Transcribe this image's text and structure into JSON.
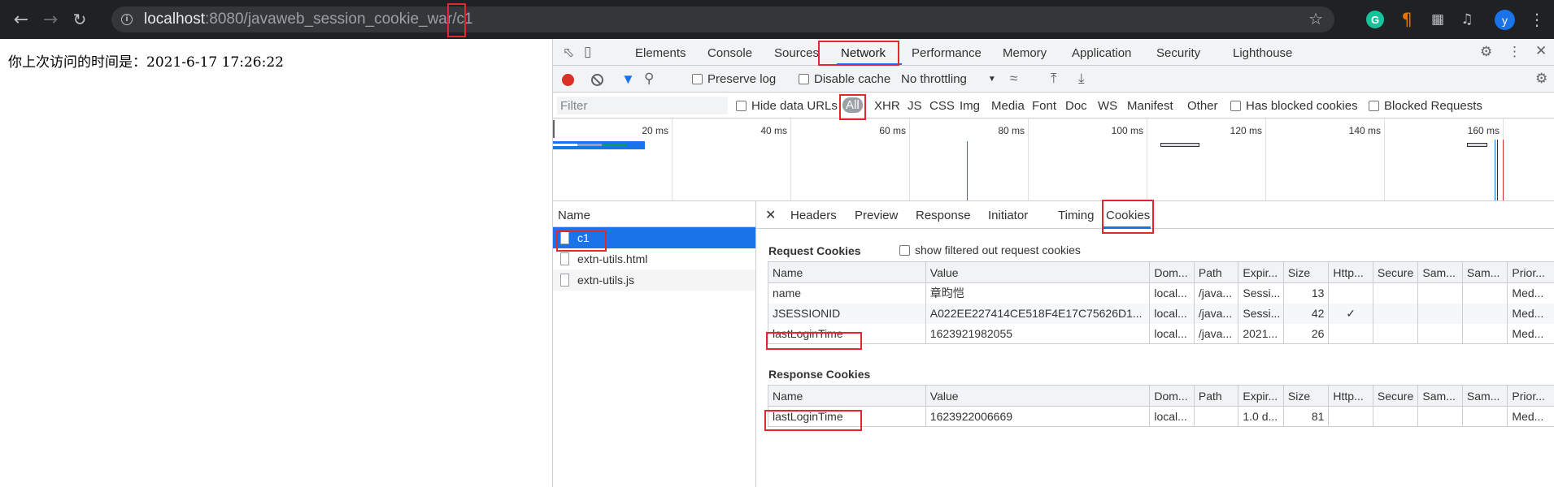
{
  "browser": {
    "url_host": "localhost",
    "url_path": ":8080/javaweb_session_cookie_war/c1",
    "grammarly_letter": "G",
    "avatar_letter": "y",
    "icons": [
      "back-arrow-icon",
      "forward-arrow-icon",
      "reload-icon",
      "info-icon",
      "star-icon",
      "grammarly-icon",
      "pilcrow-icon",
      "puzzle-icon",
      "media-queue-icon",
      "more-vert-icon"
    ]
  },
  "page": {
    "text": "你上次访问的时间是：2021-6-17 17:26:22"
  },
  "devtools": {
    "tabs": [
      "Elements",
      "Console",
      "Sources",
      "Network",
      "Performance",
      "Memory",
      "Application",
      "Security",
      "Lighthouse"
    ],
    "active_tab": "Network",
    "toolbar": {
      "preserve_log": "Preserve log",
      "disable_cache": "Disable cache",
      "throttling": "No throttling"
    },
    "filter": {
      "placeholder": "Filter",
      "hide_data_urls": "Hide data URLs",
      "types": [
        "All",
        "XHR",
        "JS",
        "CSS",
        "Img",
        "Media",
        "Font",
        "Doc",
        "WS",
        "Manifest",
        "Other"
      ],
      "active_type": "All",
      "has_blocked_cookies": "Has blocked cookies",
      "blocked_requests": "Blocked Requests"
    },
    "overview_ticks": [
      "20 ms",
      "40 ms",
      "60 ms",
      "80 ms",
      "100 ms",
      "120 ms",
      "140 ms",
      "160 ms"
    ],
    "requests": {
      "header": "Name",
      "items": [
        "c1",
        "extn-utils.html",
        "extn-utils.js"
      ],
      "selected": "c1"
    },
    "detail_tabs": [
      "Headers",
      "Preview",
      "Response",
      "Initiator",
      "Timing",
      "Cookies"
    ],
    "active_detail_tab": "Cookies",
    "request_cookies": {
      "title": "Request Cookies",
      "show_filtered": "show filtered out request cookies",
      "columns": [
        "Name",
        "Value",
        "Dom...",
        "Path",
        "Expir...",
        "Size",
        "Http...",
        "Secure",
        "Sam...",
        "Sam...",
        "Prior..."
      ],
      "rows": [
        [
          "name",
          "章昀恺",
          "local...",
          "/java...",
          "Sessi...",
          "13",
          "",
          "",
          "",
          "",
          "Med..."
        ],
        [
          "JSESSIONID",
          "A022EE227414CE518F4E17C75626D1...",
          "local...",
          "/java...",
          "Sessi...",
          "42",
          "✓",
          "",
          "",
          "",
          "Med..."
        ],
        [
          "lastLoginTime",
          "1623921982055",
          "local...",
          "/java...",
          "2021...",
          "26",
          "",
          "",
          "",
          "",
          "Med..."
        ]
      ]
    },
    "response_cookies": {
      "title": "Response Cookies",
      "columns": [
        "Name",
        "Value",
        "Dom...",
        "Path",
        "Expir...",
        "Size",
        "Http...",
        "Secure",
        "Sam...",
        "Sam...",
        "Prior..."
      ],
      "rows": [
        [
          "lastLoginTime",
          "1623922006669",
          "local...",
          "",
          "1.0 d...",
          "81",
          "",
          "",
          "",
          "",
          "Med..."
        ]
      ]
    },
    "colors": {
      "accent": "#1a73e8",
      "highlight": "#e0282e",
      "record": "#d93025"
    }
  }
}
